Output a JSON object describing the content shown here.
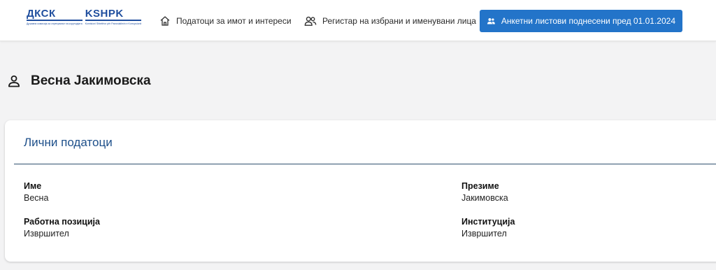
{
  "logo": {
    "left_abbr": "ДКСК",
    "left_sub": "Државна комисија за спречување на корупцијата",
    "right_abbr": "KSHPK",
    "right_sub": "Komisioni Shtetëror për Parandalimin e Korrupsionit",
    "brand_color": "#1f4e9e"
  },
  "nav": {
    "home": {
      "label": "Податоци за имот и интереси",
      "icon": "home-icon"
    },
    "registry": {
      "label": "Регистар на избрани и именувани лица",
      "icon": "people-icon"
    },
    "active": {
      "label": "Анкетни листови поднесени пред 01.01.2024",
      "icon": "people-icon",
      "color": "#2374c9"
    }
  },
  "person": {
    "icon": "person-icon",
    "name": "Весна Јакимовска"
  },
  "personal_data": {
    "title": "Лични податоци",
    "fields": {
      "first_name": {
        "label": "Име",
        "value": "Весна"
      },
      "last_name": {
        "label": "Презиме",
        "value": "Јакимовска"
      },
      "position": {
        "label": "Работна позиција",
        "value": "Извршител"
      },
      "institution": {
        "label": "Институција",
        "value": "Извршител"
      }
    }
  }
}
